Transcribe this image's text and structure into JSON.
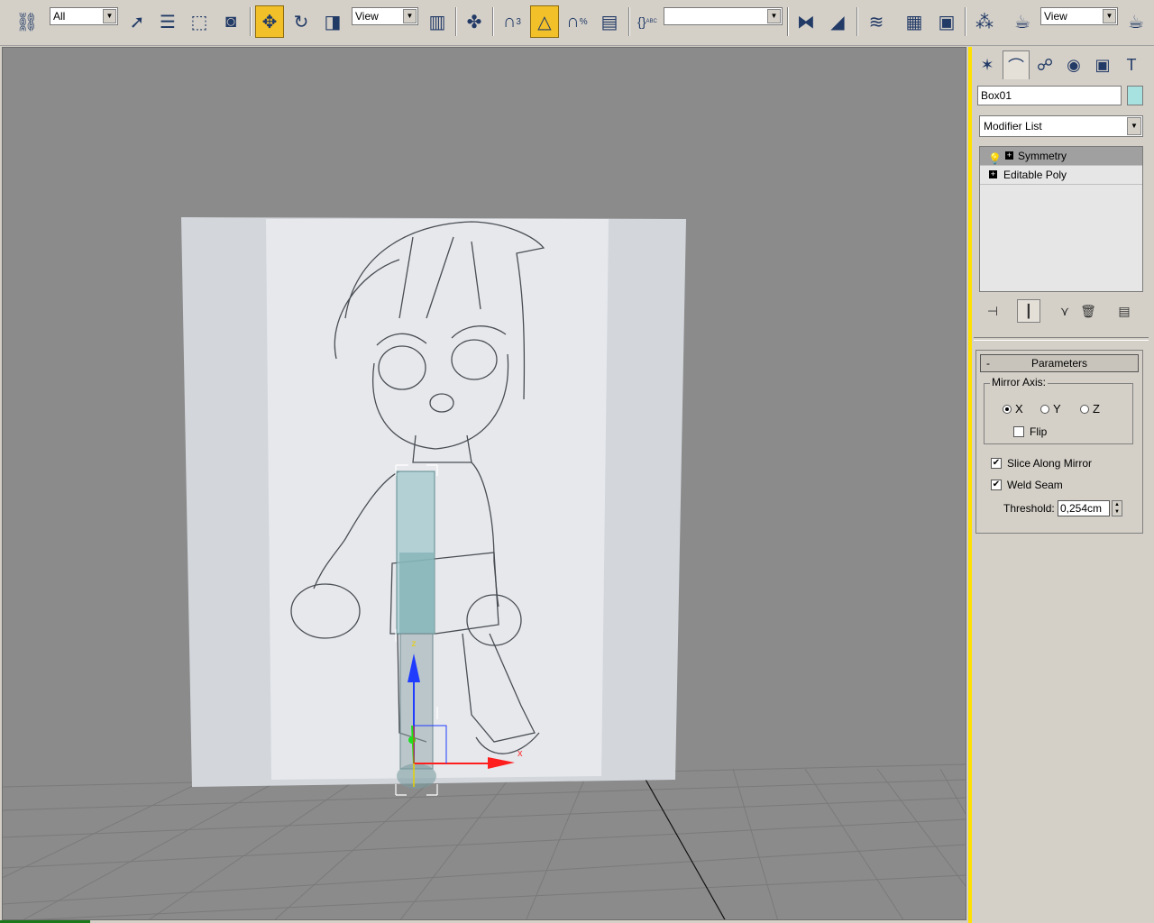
{
  "toolbar": {
    "selection_filter": "All",
    "reference_coord_1": "View",
    "reference_coord_2": "View",
    "named_selection": "",
    "snap_label": "3",
    "percent_snap_label": "%",
    "named_selection_abc": "ABC",
    "icons": [
      "undo-redo-icon",
      "select-and-link-icon",
      "select-object-icon",
      "select-by-name-icon",
      "rectangle-selection-icon",
      "window-crossing-icon",
      "select-and-move-icon",
      "select-and-rotate-icon",
      "select-and-scale-icon",
      "use-pivot-center-icon",
      "select-manipulate-icon",
      "snap-toggle-icon",
      "angle-snap-icon",
      "percent-snap-icon",
      "spinner-snap-icon",
      "edit-named-selections-icon",
      "mirror-icon",
      "align-icon",
      "layer-manager-icon",
      "curve-editor-icon",
      "schematic-view-icon",
      "material-editor-icon",
      "render-setup-icon",
      "quick-render-icon"
    ]
  },
  "panel": {
    "tabs": [
      "create-tab",
      "modify-tab",
      "hierarchy-tab",
      "motion-tab",
      "display-tab",
      "utilities-tab"
    ],
    "object_name": "Box01",
    "object_color": "#a8e2e0",
    "modifier_list_label": "Modifier List",
    "stack": [
      {
        "label": "Symmetry",
        "selected": true
      },
      {
        "label": "Editable Poly",
        "selected": false
      }
    ],
    "parameters": {
      "header": "Parameters",
      "collapse_symbol": "-",
      "mirror_axis_label": "Mirror Axis:",
      "axes": [
        {
          "label": "X",
          "selected": true
        },
        {
          "label": "Y",
          "selected": false
        },
        {
          "label": "Z",
          "selected": false
        }
      ],
      "flip_label": "Flip",
      "flip_checked": false,
      "slice_label": "Slice Along Mirror",
      "slice_checked": true,
      "weld_label": "Weld Seam",
      "weld_checked": true,
      "threshold_label": "Threshold:",
      "threshold_value": "0,254cm"
    }
  },
  "viewport": {
    "gizmo_labels": {
      "x": "x",
      "y": "y",
      "z": "z"
    },
    "background_color": "#8b8b8b"
  }
}
